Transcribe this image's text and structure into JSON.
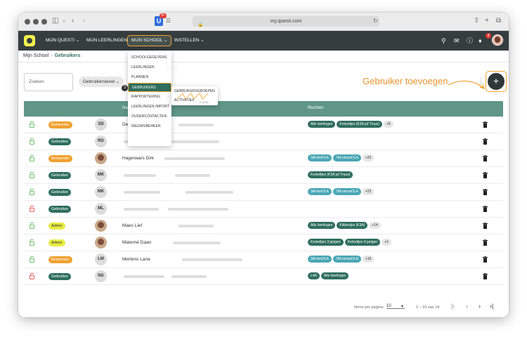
{
  "browser": {
    "url": "my.questi.com",
    "extension_badge": "9+"
  },
  "navbar": {
    "items": [
      "MIJN QUESTI",
      "MIJN LEERLINGEN",
      "MIJN SCHOOL",
      "INSTELLEN"
    ],
    "notification_count": "4"
  },
  "breadcrumb": {
    "root": "Mijn School",
    "current": "Gebruikers"
  },
  "toolbar": {
    "search_placeholder": "Zoeken",
    "filter_label": "Gebruikerslevel",
    "add_label": "Gebruiker toevoegen"
  },
  "menu": {
    "items": [
      "SCHOOLGEGEVENS",
      "LEERLINGEN",
      "PLANNEN",
      "GEBRUIKERS",
      "RAPPORTERING",
      "LEERLINGEN IMPORT",
      "OUDERCONTACTEN",
      "NIEUWSBEHEER"
    ],
    "selected": "GEBRUIKERS",
    "step": "3",
    "submenu": [
      "GEBRUIKERSGROEPEN",
      "ACTIVATIES"
    ],
    "submenu_hint": "E-MAIL"
  },
  "table": {
    "headers": [
      "Na",
      "Rechten"
    ],
    "rows": [
      {
        "role": "Beheerder",
        "role_class": "beheerder",
        "lock_color": "#6bc06b",
        "initials": "SD",
        "name": "De",
        "tags": [
          {
            "t": "Alle leerlingen",
            "c": ""
          },
          {
            "t": "Krekeltjes (K3A juf Truus)",
            "c": ""
          },
          {
            "t": "+9",
            "c": "more"
          }
        ]
      },
      {
        "role": "Gebruiker",
        "role_class": "gebruiker",
        "lock_color": "#6bc06b",
        "initials": "RD",
        "name": "",
        "tags": []
      },
      {
        "role": "Beheerder",
        "role_class": "beheerder",
        "lock_color": "#6bc06b",
        "initials": "",
        "photo": true,
        "name": "Hagenaars Dirk",
        "tags": [
          {
            "t": "3At-bmDLA",
            "c": "teal"
          },
          {
            "t": "7At-omzwDLA",
            "c": "teal"
          },
          {
            "t": "+22",
            "c": "more"
          }
        ]
      },
      {
        "role": "Gebruiker",
        "role_class": "gebruiker",
        "lock_color": "#6bc06b",
        "initials": "MK",
        "name": "",
        "tags": [
          {
            "t": "Krekeltjes (K3A juf Truus)",
            "c": ""
          }
        ]
      },
      {
        "role": "Gebruiker",
        "role_class": "gebruiker",
        "lock_color": "#6bc06b",
        "initials": "MK",
        "name": "",
        "tags": [
          {
            "t": "3At-bmDLA",
            "c": "teal"
          },
          {
            "t": "7At-omzwDLA",
            "c": "teal"
          },
          {
            "t": "+22",
            "c": "more"
          }
        ]
      },
      {
        "role": "Gebruiker",
        "role_class": "gebruiker",
        "lock_color": "#e8605a",
        "initials": "ML",
        "name": "",
        "tags": []
      },
      {
        "role": "Admin",
        "role_class": "admin",
        "lock_color": "#6bc06b",
        "initials": "",
        "photo": true,
        "name": "Maes Lief",
        "tags": [
          {
            "t": "Alle leerlingen",
            "c": ""
          },
          {
            "t": "Kikkertjes (K3A)",
            "c": ""
          },
          {
            "t": "+14",
            "c": "more"
          }
        ]
      },
      {
        "role": "Admin",
        "role_class": "admin",
        "lock_color": "#6bc06b",
        "initials": "",
        "photo": true,
        "name": "Materné Daan",
        "tags": [
          {
            "t": "Krekeltjes 3 jarigen",
            "c": ""
          },
          {
            "t": "Krekeltjes 4 jarigen",
            "c": ""
          },
          {
            "t": "+2",
            "c": "more"
          }
        ]
      },
      {
        "role": "Beheerder",
        "role_class": "beheerder",
        "lock_color": "#6bc06b",
        "initials": "LM",
        "name": "Mertens Lana",
        "tags": [
          {
            "t": "3At-bmDLA",
            "c": "teal"
          },
          {
            "t": "7At-omzwDLA",
            "c": "teal"
          },
          {
            "t": "+16",
            "c": "more"
          }
        ]
      },
      {
        "role": "Gebruiker",
        "role_class": "gebruiker",
        "lock_color": "#e8605a",
        "initials": "NS",
        "name": "",
        "tags": [
          {
            "t": "L4A",
            "c": ""
          },
          {
            "t": "Alle leerlingen",
            "c": ""
          }
        ]
      }
    ]
  },
  "pagination": {
    "items_per_page_label": "Items per pagina:",
    "items_per_page": "10",
    "range": "1 – 10 van 14"
  },
  "colors": {
    "brand": "#363d3f",
    "accent": "#f0a030",
    "primary": "#2f6e5e",
    "table_header": "#5f9686"
  }
}
